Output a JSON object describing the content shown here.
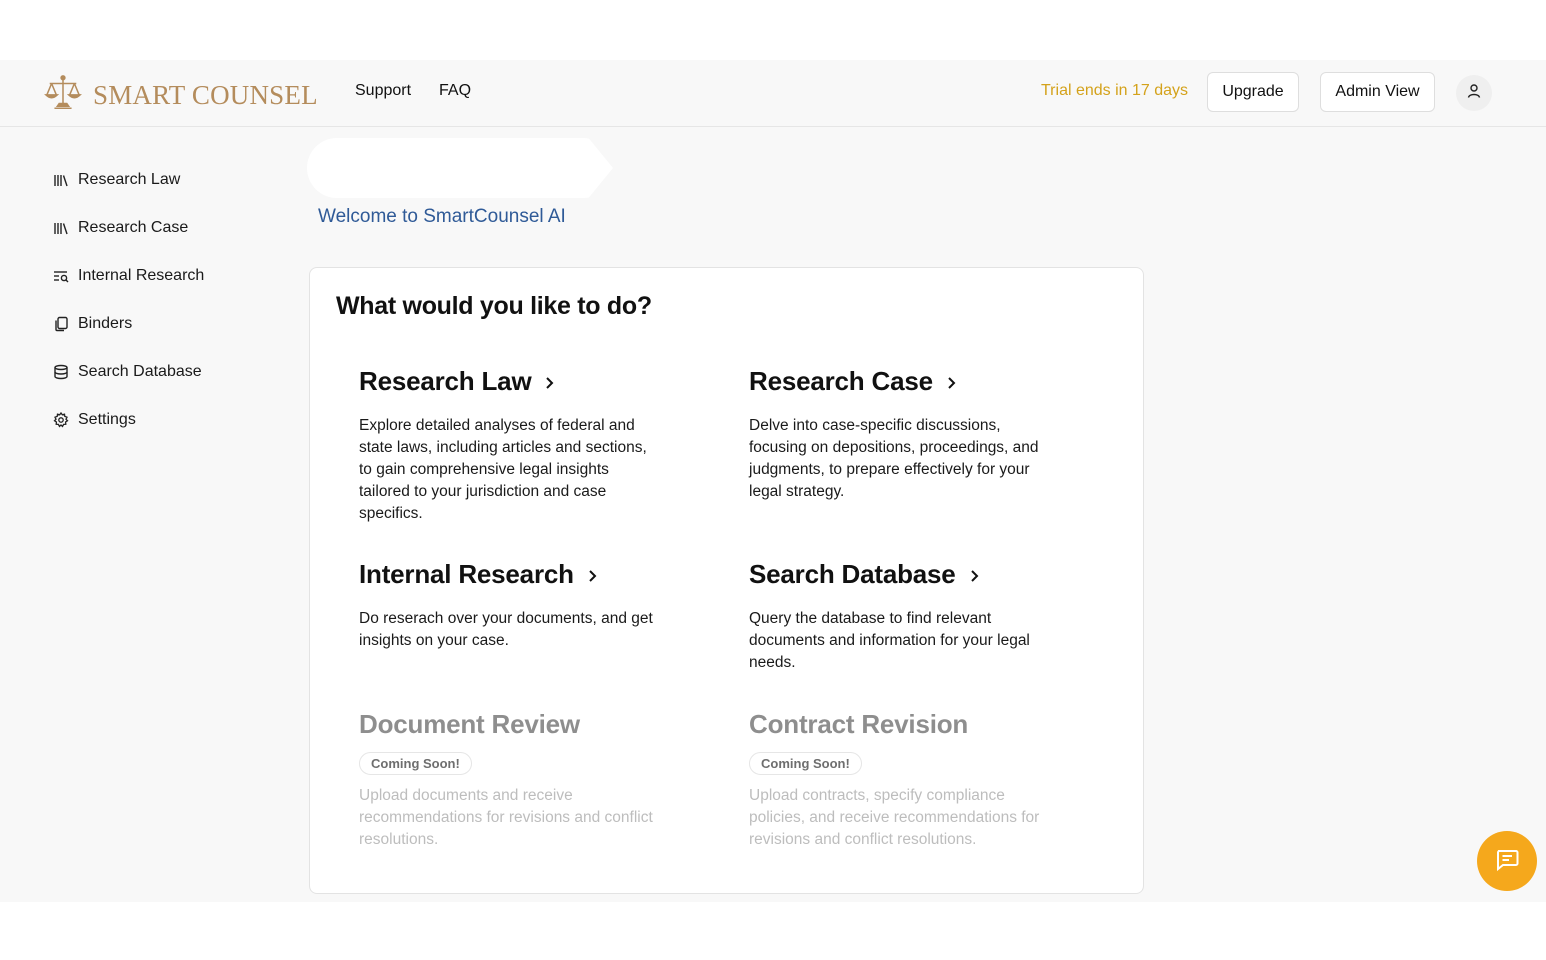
{
  "header": {
    "logo_text": "SMART COUNSEL",
    "nav": [
      {
        "label": "Support"
      },
      {
        "label": "FAQ"
      }
    ],
    "trial_text": "Trial ends in 17 days",
    "upgrade_label": "Upgrade",
    "admin_view_label": "Admin View",
    "accent_color": "#d4a21b",
    "logo_color": "#b48c5c"
  },
  "sidebar": {
    "items": [
      {
        "label": "Research Law",
        "icon": "library-icon"
      },
      {
        "label": "Research Case",
        "icon": "library-icon"
      },
      {
        "label": "Internal Research",
        "icon": "text-search-icon"
      },
      {
        "label": "Binders",
        "icon": "copy-icon"
      },
      {
        "label": "Search Database",
        "icon": "database-icon"
      },
      {
        "label": "Settings",
        "icon": "gear-icon"
      }
    ]
  },
  "main": {
    "welcome": "Welcome to SmartCounsel AI",
    "card_title": "What would you like to do?",
    "tiles": [
      {
        "title": "Research Law",
        "description": "Explore detailed analyses of federal and state laws, including articles and sections, to gain comprehensive legal insights tailored to your jurisdiction and case specifics."
      },
      {
        "title": "Research Case",
        "description": "Delve into case-specific discussions, focusing on depositions, proceedings, and judgments, to prepare effectively for your legal strategy."
      },
      {
        "title": "Internal Research",
        "description": "Do reserach over your documents, and get insights on your case."
      },
      {
        "title": "Search Database",
        "description": "Query the database to find relevant documents and information for your legal needs."
      },
      {
        "title": "Document Review",
        "badge": "Coming Soon!",
        "description": "Upload documents and receive recommendations for revisions and conflict resolutions."
      },
      {
        "title": "Contract Revision",
        "badge": "Coming Soon!",
        "description": "Upload contracts, specify compliance policies, and receive recommendations for revisions and conflict resolutions."
      }
    ]
  },
  "chat_button": {
    "icon": "chat-icon",
    "color": "#f5a81c"
  }
}
